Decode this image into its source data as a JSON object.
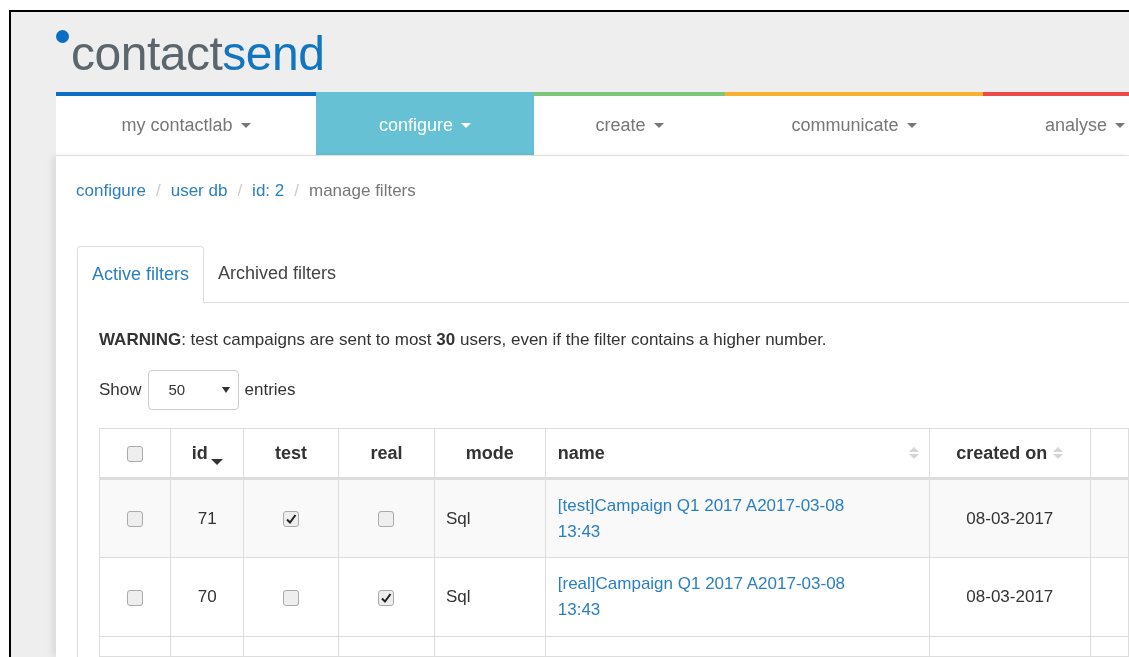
{
  "logo": {
    "text_1": "contact",
    "text_2": "send"
  },
  "navigation": [
    {
      "label": "my contactlab",
      "selected": false,
      "color": "#0a6fc2"
    },
    {
      "label": "configure",
      "selected": true,
      "color": "#67c1d5"
    },
    {
      "label": "create",
      "selected": false,
      "color": "#7dc57b"
    },
    {
      "label": "communicate",
      "selected": false,
      "color": "#f7b12f"
    },
    {
      "label": "analyse",
      "selected": false,
      "color": "#ec4a4a"
    }
  ],
  "breadcrumb_separator": "/",
  "breadcrumb": [
    {
      "label": "configure",
      "kind": "link"
    },
    {
      "label": "user db",
      "kind": "link"
    },
    {
      "label": "id: 2",
      "kind": "link"
    },
    {
      "label": "manage filters",
      "kind": "current"
    }
  ],
  "tabs": [
    {
      "label": "Active filters",
      "selected": true
    },
    {
      "label": "Archived filters",
      "selected": false
    }
  ],
  "warning": "**WARNING**: test campaigns are sent to most **30** users, even if the filter contains a higher number.",
  "length_menu": {
    "label_before": "Show",
    "value": "50",
    "label_after": "entries"
  },
  "table": {
    "columns": [
      {
        "kind": "checkbox",
        "checked": false
      },
      {
        "kind": "text",
        "label": "id",
        "sortable": true,
        "sorted": true
      },
      {
        "kind": "text",
        "label": "test",
        "sortable": false,
        "sorted": false
      },
      {
        "kind": "text",
        "label": "real",
        "sortable": false,
        "sorted": false
      },
      {
        "kind": "text",
        "label": "mode",
        "sortable": false,
        "sorted": false
      },
      {
        "kind": "text",
        "label": "name",
        "sortable": true,
        "sorted": false
      },
      {
        "kind": "text",
        "label": "created on",
        "sortable": true,
        "sorted": false
      }
    ],
    "rows": [
      {
        "checked": false,
        "id": "71",
        "test": true,
        "real": false,
        "mode": "Sql",
        "name": "[test]Campaign Q1 2017 A2017-03-08 13:43",
        "created_on": "08-03-2017"
      },
      {
        "checked": false,
        "id": "70",
        "test": false,
        "real": true,
        "mode": "Sql",
        "name": "[real]Campaign Q1 2017 A2017-03-08 13:43",
        "created_on": "08-03-2017"
      }
    ]
  }
}
